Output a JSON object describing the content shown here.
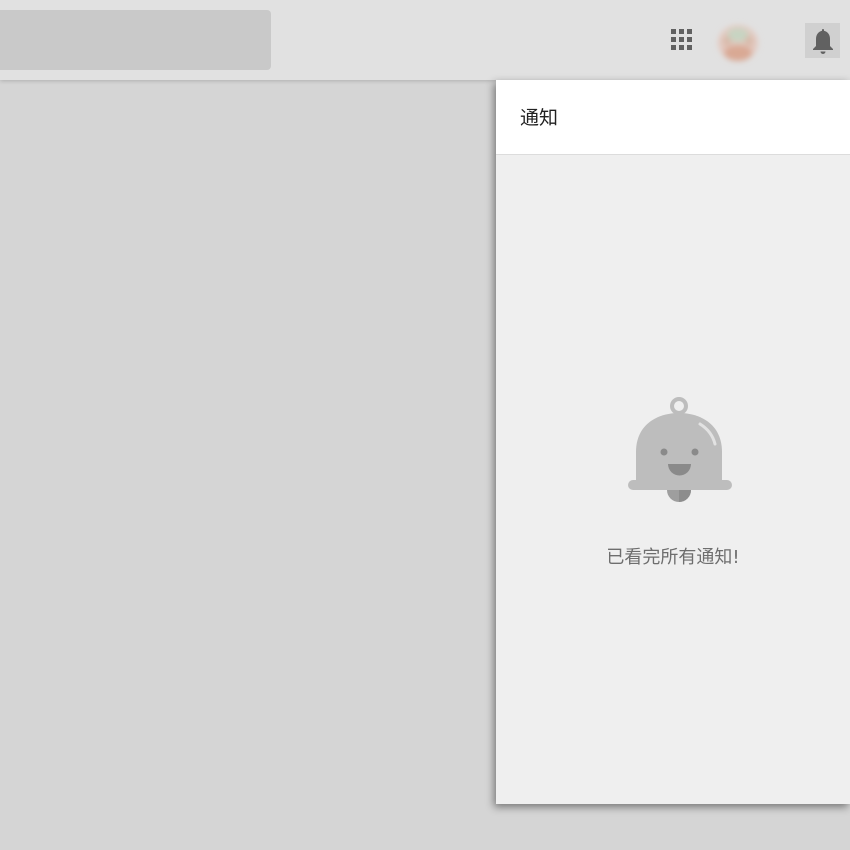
{
  "header": {
    "search": {
      "value": "",
      "placeholder": ""
    },
    "icons": {
      "apps": "apps-grid-icon",
      "avatar": "user-avatar",
      "notifications": "bell-icon"
    }
  },
  "notifications": {
    "title": "通知",
    "empty_message": "已看完所有通知!",
    "empty_icon": "smiling-bell-icon"
  },
  "colors": {
    "topbar": "#e1e1e1",
    "background": "#d5d5d5",
    "panel": "#efefef",
    "icon_gray": "#616161"
  }
}
